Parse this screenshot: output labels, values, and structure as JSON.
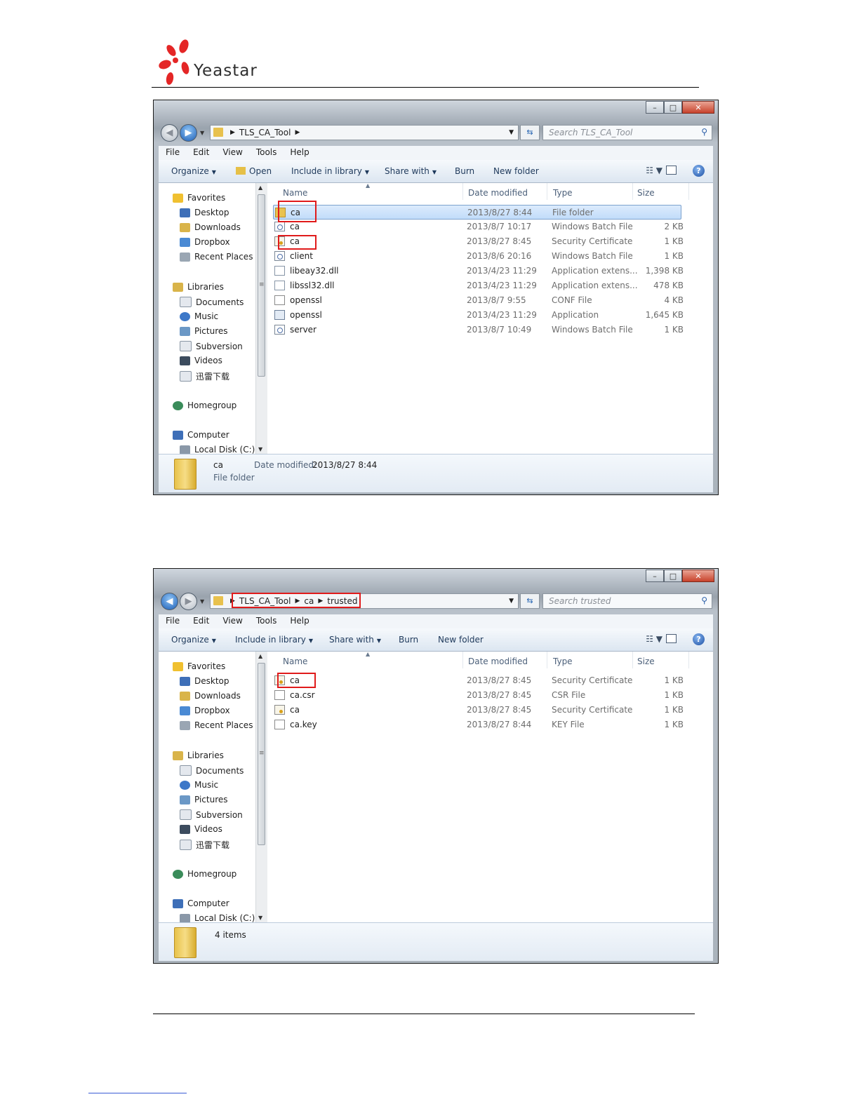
{
  "logo": {
    "text": "Yeastar"
  },
  "window1": {
    "breadcrumb": [
      "TLS_CA_Tool"
    ],
    "search_placeholder": "Search TLS_CA_Tool",
    "menu": [
      "File",
      "Edit",
      "View",
      "Tools",
      "Help"
    ],
    "toolbar": {
      "organize": "Organize",
      "open": "Open",
      "include": "Include in library",
      "share": "Share with",
      "burn": "Burn",
      "new_folder": "New folder"
    },
    "nav": {
      "favorites": "Favorites",
      "desktop": "Desktop",
      "downloads": "Downloads",
      "dropbox": "Dropbox",
      "recent": "Recent Places",
      "libraries": "Libraries",
      "documents": "Documents",
      "music": "Music",
      "pictures": "Pictures",
      "subversion": "Subversion",
      "videos": "Videos",
      "xunlei": "迅雷下载",
      "homegroup": "Homegroup",
      "computer": "Computer",
      "localdisk": "Local Disk (C:)"
    },
    "columns": {
      "name": "Name",
      "date": "Date modified",
      "type": "Type",
      "size": "Size"
    },
    "files": [
      {
        "name": "ca",
        "date": "2013/8/27 8:44",
        "type": "File folder",
        "size": "",
        "icon": "folder-icon"
      },
      {
        "name": "ca",
        "date": "2013/8/7 10:17",
        "type": "Windows Batch File",
        "size": "2 KB",
        "icon": "batch-file-icon"
      },
      {
        "name": "ca",
        "date": "2013/8/27 8:45",
        "type": "Security Certificate",
        "size": "1 KB",
        "icon": "certificate-icon"
      },
      {
        "name": "client",
        "date": "2013/8/6 20:16",
        "type": "Windows Batch File",
        "size": "1 KB",
        "icon": "batch-file-icon"
      },
      {
        "name": "libeay32.dll",
        "date": "2013/4/23 11:29",
        "type": "Application extens...",
        "size": "1,398 KB",
        "icon": "dll-icon"
      },
      {
        "name": "libssl32.dll",
        "date": "2013/4/23 11:29",
        "type": "Application extens...",
        "size": "478 KB",
        "icon": "dll-icon"
      },
      {
        "name": "openssl",
        "date": "2013/8/7 9:55",
        "type": "CONF File",
        "size": "4 KB",
        "icon": "conf-file-icon"
      },
      {
        "name": "openssl",
        "date": "2013/4/23 11:29",
        "type": "Application",
        "size": "1,645 KB",
        "icon": "application-icon"
      },
      {
        "name": "server",
        "date": "2013/8/7 10:49",
        "type": "Windows Batch File",
        "size": "1 KB",
        "icon": "batch-file-icon"
      }
    ],
    "details": {
      "name": "ca",
      "date_label": "Date modified:",
      "date_value": "2013/8/27 8:44",
      "kind": "File folder"
    }
  },
  "window2": {
    "breadcrumb": [
      "TLS_CA_Tool",
      "ca",
      "trusted"
    ],
    "search_placeholder": "Search trusted",
    "menu": [
      "File",
      "Edit",
      "View",
      "Tools",
      "Help"
    ],
    "toolbar": {
      "organize": "Organize",
      "include": "Include in library",
      "share": "Share with",
      "burn": "Burn",
      "new_folder": "New folder"
    },
    "nav": {
      "favorites": "Favorites",
      "desktop": "Desktop",
      "downloads": "Downloads",
      "dropbox": "Dropbox",
      "recent": "Recent Places",
      "libraries": "Libraries",
      "documents": "Documents",
      "music": "Music",
      "pictures": "Pictures",
      "subversion": "Subversion",
      "videos": "Videos",
      "xunlei": "迅雷下载",
      "homegroup": "Homegroup",
      "computer": "Computer",
      "localdisk": "Local Disk (C:)"
    },
    "columns": {
      "name": "Name",
      "date": "Date modified",
      "type": "Type",
      "size": "Size"
    },
    "files": [
      {
        "name": "ca",
        "date": "2013/8/27 8:45",
        "type": "Security Certificate",
        "size": "1 KB",
        "icon": "certificate-icon"
      },
      {
        "name": "ca.csr",
        "date": "2013/8/27 8:45",
        "type": "CSR File",
        "size": "1 KB",
        "icon": "blank-file-icon"
      },
      {
        "name": "ca",
        "date": "2013/8/27 8:45",
        "type": "Security Certificate",
        "size": "1 KB",
        "icon": "certificate-icon"
      },
      {
        "name": "ca.key",
        "date": "2013/8/27 8:44",
        "type": "KEY File",
        "size": "1 KB",
        "icon": "blank-file-icon"
      }
    ],
    "details": {
      "count": "4 items"
    }
  },
  "colors": {
    "highlight": "#e01b1b",
    "selection": "#c1dcfa"
  }
}
